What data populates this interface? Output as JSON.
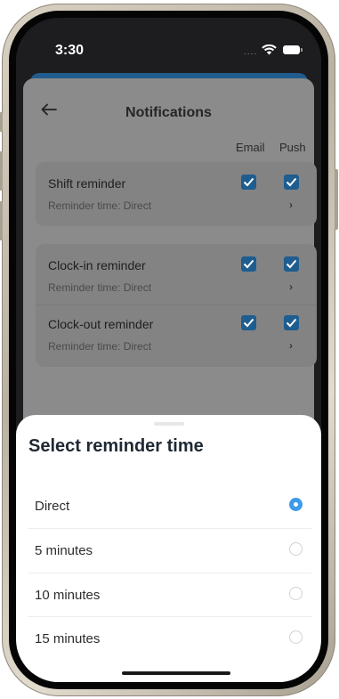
{
  "status_bar": {
    "time": "3:30",
    "dots": "....",
    "icons": [
      "wifi-icon",
      "battery-icon"
    ]
  },
  "header": {
    "back_icon": "arrow-left-icon",
    "title": "Notifications"
  },
  "columns": {
    "email": "Email",
    "push": "Push"
  },
  "reminders": [
    {
      "title": "Shift reminder",
      "subtitle": "Reminder time: Direct",
      "email": true,
      "push": true
    },
    {
      "title": "Clock-in reminder",
      "subtitle": "Reminder time: Direct",
      "email": true,
      "push": true
    },
    {
      "title": "Clock-out reminder",
      "subtitle": "Reminder time: Direct",
      "email": true,
      "push": true
    }
  ],
  "sheet": {
    "title": "Select reminder time",
    "options": [
      {
        "label": "Direct",
        "selected": true
      },
      {
        "label": "5 minutes",
        "selected": false
      },
      {
        "label": "10 minutes",
        "selected": false
      },
      {
        "label": "15 minutes",
        "selected": false
      }
    ]
  },
  "colors": {
    "accent": "#3d9be9",
    "brand_blue": "#205c8d",
    "checkbox_dimmed": "#1e5d8f"
  }
}
